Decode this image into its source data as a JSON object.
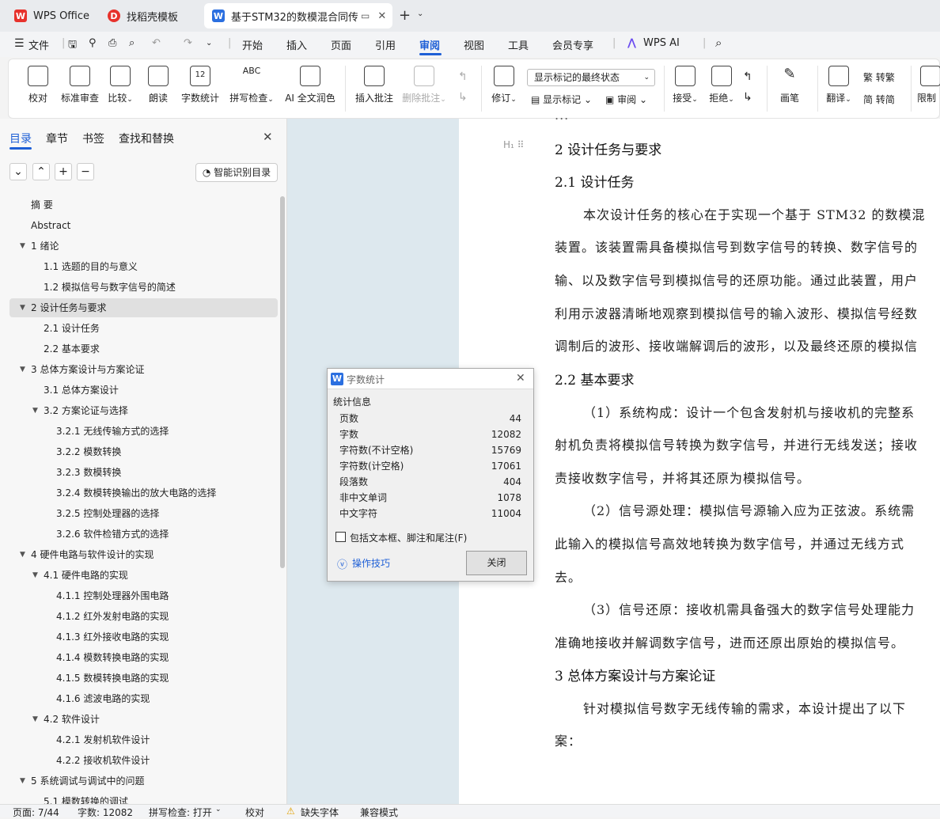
{
  "tabs": [
    {
      "label": "WPS Office",
      "icon": "wps-logo-icon"
    },
    {
      "label": "找稻壳模板",
      "icon": "docer-icon"
    },
    {
      "label": "基于STM32的数模混合同传",
      "icon": "word-doc-icon"
    }
  ],
  "menu": {
    "file": "文件",
    "items": [
      "开始",
      "插入",
      "页面",
      "引用",
      "审阅",
      "视图",
      "工具",
      "会员专享"
    ],
    "active": "审阅",
    "wps_ai": "WPS AI"
  },
  "ribbon": {
    "proofread": "校对",
    "std_review": "标准审查",
    "compare": "比较",
    "read_aloud": "朗读",
    "word_count": "字数统计",
    "spell_check": "拼写检查",
    "ai_polish": "AI 全文润色",
    "insert_comment": "插入批注",
    "delete_comment": "删除批注",
    "revise": "修订",
    "markup_dropdown": "显示标记的最终状态",
    "show_markup": "显示标记",
    "review": "审阅",
    "accept": "接受",
    "reject": "拒绝",
    "brush": "画笔",
    "translate": "翻译",
    "to_trad": "转繁",
    "to_simp": "转简",
    "restrict": "限制"
  },
  "sidebar": {
    "tabs": [
      "目录",
      "章节",
      "书签",
      "查找和替换"
    ],
    "smart_toc": "智能识别目录",
    "toc": [
      {
        "label": "摘  要",
        "level": 0
      },
      {
        "label": "Abstract",
        "level": 0
      },
      {
        "label": "1  绪论",
        "level": 0,
        "expand": true
      },
      {
        "label": "1.1  选题的目的与意义",
        "level": 1
      },
      {
        "label": "1.2  模拟信号与数字信号的简述",
        "level": 1
      },
      {
        "label": "2  设计任务与要求",
        "level": 0,
        "expand": true,
        "selected": true
      },
      {
        "label": "2.1  设计任务",
        "level": 1
      },
      {
        "label": "2.2    基本要求",
        "level": 1
      },
      {
        "label": "3  总体方案设计与方案论证",
        "level": 0,
        "expand": true
      },
      {
        "label": "3.1 总体方案设计",
        "level": 1
      },
      {
        "label": "3.2  方案论证与选择",
        "level": 1,
        "expand": true
      },
      {
        "label": "3.2.1  无线传输方式的选择",
        "level": 2
      },
      {
        "label": "3.2.2  模数转换",
        "level": 2
      },
      {
        "label": "3.2.3  数模转换",
        "level": 2
      },
      {
        "label": "3.2.4  数模转换输出的放大电路的选择",
        "level": 2
      },
      {
        "label": "3.2.5  控制处理器的选择",
        "level": 2
      },
      {
        "label": "3.2.6  软件检错方式的选择",
        "level": 2
      },
      {
        "label": "4  硬件电路与软件设计的实现",
        "level": 0,
        "expand": true
      },
      {
        "label": "4.1  硬件电路的实现",
        "level": 1,
        "expand": true
      },
      {
        "label": "4.1.1  控制处理器外围电路",
        "level": 2
      },
      {
        "label": "4.1.2  红外发射电路的实现",
        "level": 2
      },
      {
        "label": "4.1.3  红外接收电路的实现",
        "level": 2
      },
      {
        "label": "4.1.4  模数转换电路的实现",
        "level": 2
      },
      {
        "label": "4.1.5 数模转换电路的实现",
        "level": 2
      },
      {
        "label": "4.1.6 滤波电路的实现",
        "level": 2
      },
      {
        "label": "4.2  软件设计",
        "level": 1,
        "expand": true
      },
      {
        "label": "4.2.1  发射机软件设计",
        "level": 2
      },
      {
        "label": "4.2.2  接收机软件设计",
        "level": 2
      },
      {
        "label": "5  系统调试与调试中的问题",
        "level": 0,
        "expand": true
      },
      {
        "label": "5.1  模数转换的调试",
        "level": 1
      }
    ]
  },
  "document": {
    "top_partial": "...",
    "h1": "2  设计任务与要求",
    "h2_1": "2.1  设计任务",
    "p1": [
      "本次设计任务的核心在于实现一个基于 STM32 的数模混",
      "装置。该装置需具备模拟信号到数字信号的转换、数字信号的",
      "输、以及数字信号到模拟信号的还原功能。通过此装置，用户",
      "利用示波器清晰地观察到模拟信号的输入波形、模拟信号经数",
      "调制后的波形、接收端解调后的波形，以及最终还原的模拟信"
    ],
    "h2_2": "2.2    基本要求",
    "p2": [
      "（1）系统构成：设计一个包含发射机与接收机的完整系",
      "射机负责将模拟信号转换为数字信号，并进行无线发送；接收",
      "责接收数字信号，并将其还原为模拟信号。"
    ],
    "p3": [
      "（2）信号源处理：模拟信号源输入应为正弦波。系统需",
      "此输入的模拟信号高效地转换为数字信号，并通过无线方式",
      "去。"
    ],
    "p4": [
      "（3）信号还原：接收机需具备强大的数字信号处理能力",
      "准确地接收并解调数字信号，进而还原出原始的模拟信号。"
    ],
    "h1_3": "3  总体方案设计与方案论证",
    "p5": [
      "针对模拟信号数字无线传输的需求，本设计提出了以下",
      "案："
    ]
  },
  "dialog": {
    "title": "字数统计",
    "section": "统计信息",
    "rows": [
      {
        "k": "页数",
        "v": "44"
      },
      {
        "k": "字数",
        "v": "12082"
      },
      {
        "k": "字符数(不计空格)",
        "v": "15769"
      },
      {
        "k": "字符数(计空格)",
        "v": "17061"
      },
      {
        "k": "段落数",
        "v": "404"
      },
      {
        "k": "非中文单词",
        "v": "1078"
      },
      {
        "k": "中文字符",
        "v": "11004"
      }
    ],
    "checkbox": "包括文本框、脚注和尾注(F)",
    "tips": "操作技巧",
    "close": "关闭"
  },
  "status": {
    "page": "页面: 7/44",
    "words": "字数: 12082",
    "spell": "拼写检查: 打开",
    "proof": "校对",
    "missing_font": "缺失字体",
    "compat": "兼容模式"
  }
}
